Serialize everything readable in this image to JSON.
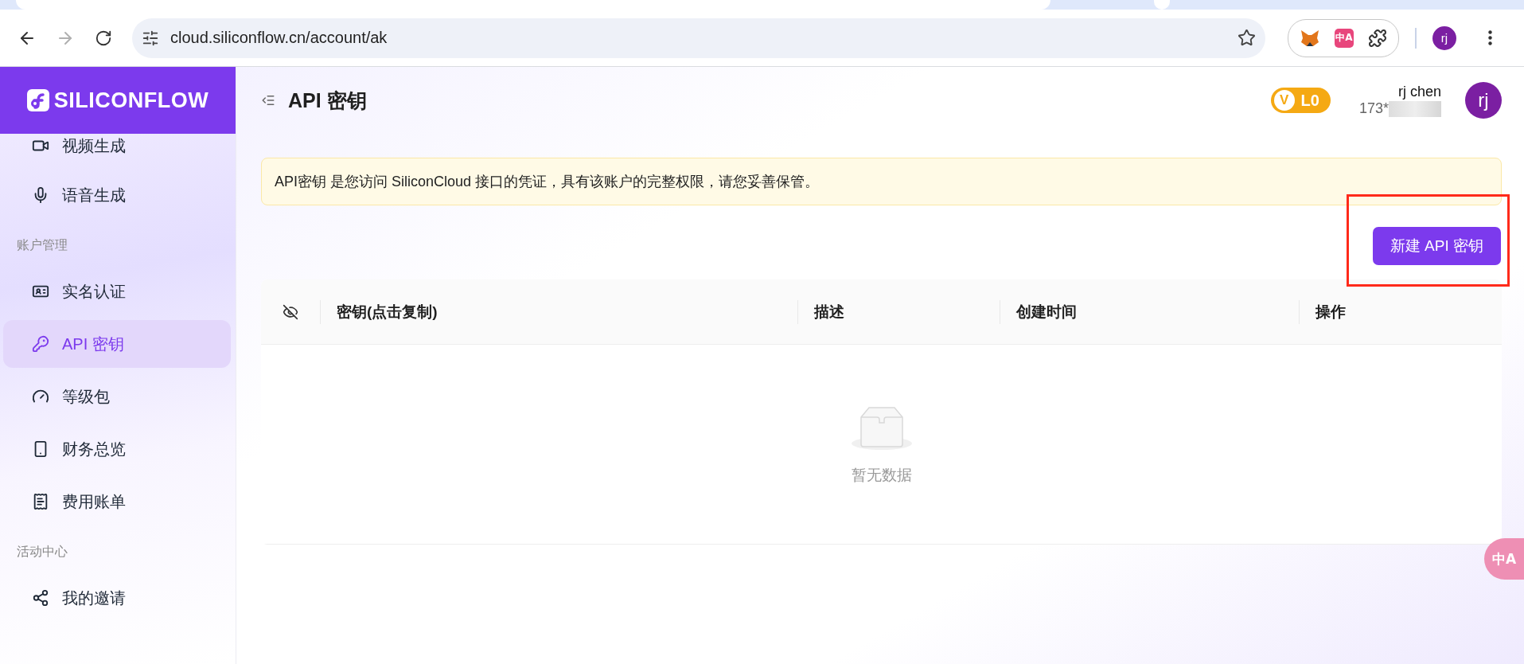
{
  "browser": {
    "url": "cloud.siliconflow.cn/account/ak",
    "back_disabled": false,
    "forward_disabled": true,
    "profile": "rj",
    "translate_icon": "中A"
  },
  "sidebar": {
    "logo": "SILICONFLOW",
    "items": [
      {
        "kind": "item",
        "label": "视频生成",
        "selected": false
      },
      {
        "kind": "item",
        "label": "语音生成",
        "selected": false
      },
      {
        "kind": "section",
        "label": "账户管理"
      },
      {
        "kind": "item",
        "label": "实名认证",
        "selected": false
      },
      {
        "kind": "item",
        "label": "API 密钥",
        "selected": true
      },
      {
        "kind": "item",
        "label": "等级包",
        "selected": false
      },
      {
        "kind": "item",
        "label": "财务总览",
        "selected": false
      },
      {
        "kind": "item",
        "label": "费用账单",
        "selected": false
      },
      {
        "kind": "section",
        "label": "活动中心"
      },
      {
        "kind": "item",
        "label": "我的邀请",
        "selected": false
      }
    ]
  },
  "header": {
    "title": "API 密钥",
    "level_badge": {
      "mark": "V",
      "label": "L0"
    },
    "user": {
      "name": "rj chen",
      "phone": "173*",
      "avatar": "rj"
    }
  },
  "alert": "API密钥 是您访问 SiliconCloud 接口的凭证，具有该账户的完整权限，请您妥善保管。",
  "create_button": "新建 API 密钥",
  "table": {
    "columns": [
      "密钥(点击复制)",
      "描述",
      "创建时间",
      "操作"
    ],
    "empty_text": "暂无数据"
  },
  "floating_translate": "中A"
}
